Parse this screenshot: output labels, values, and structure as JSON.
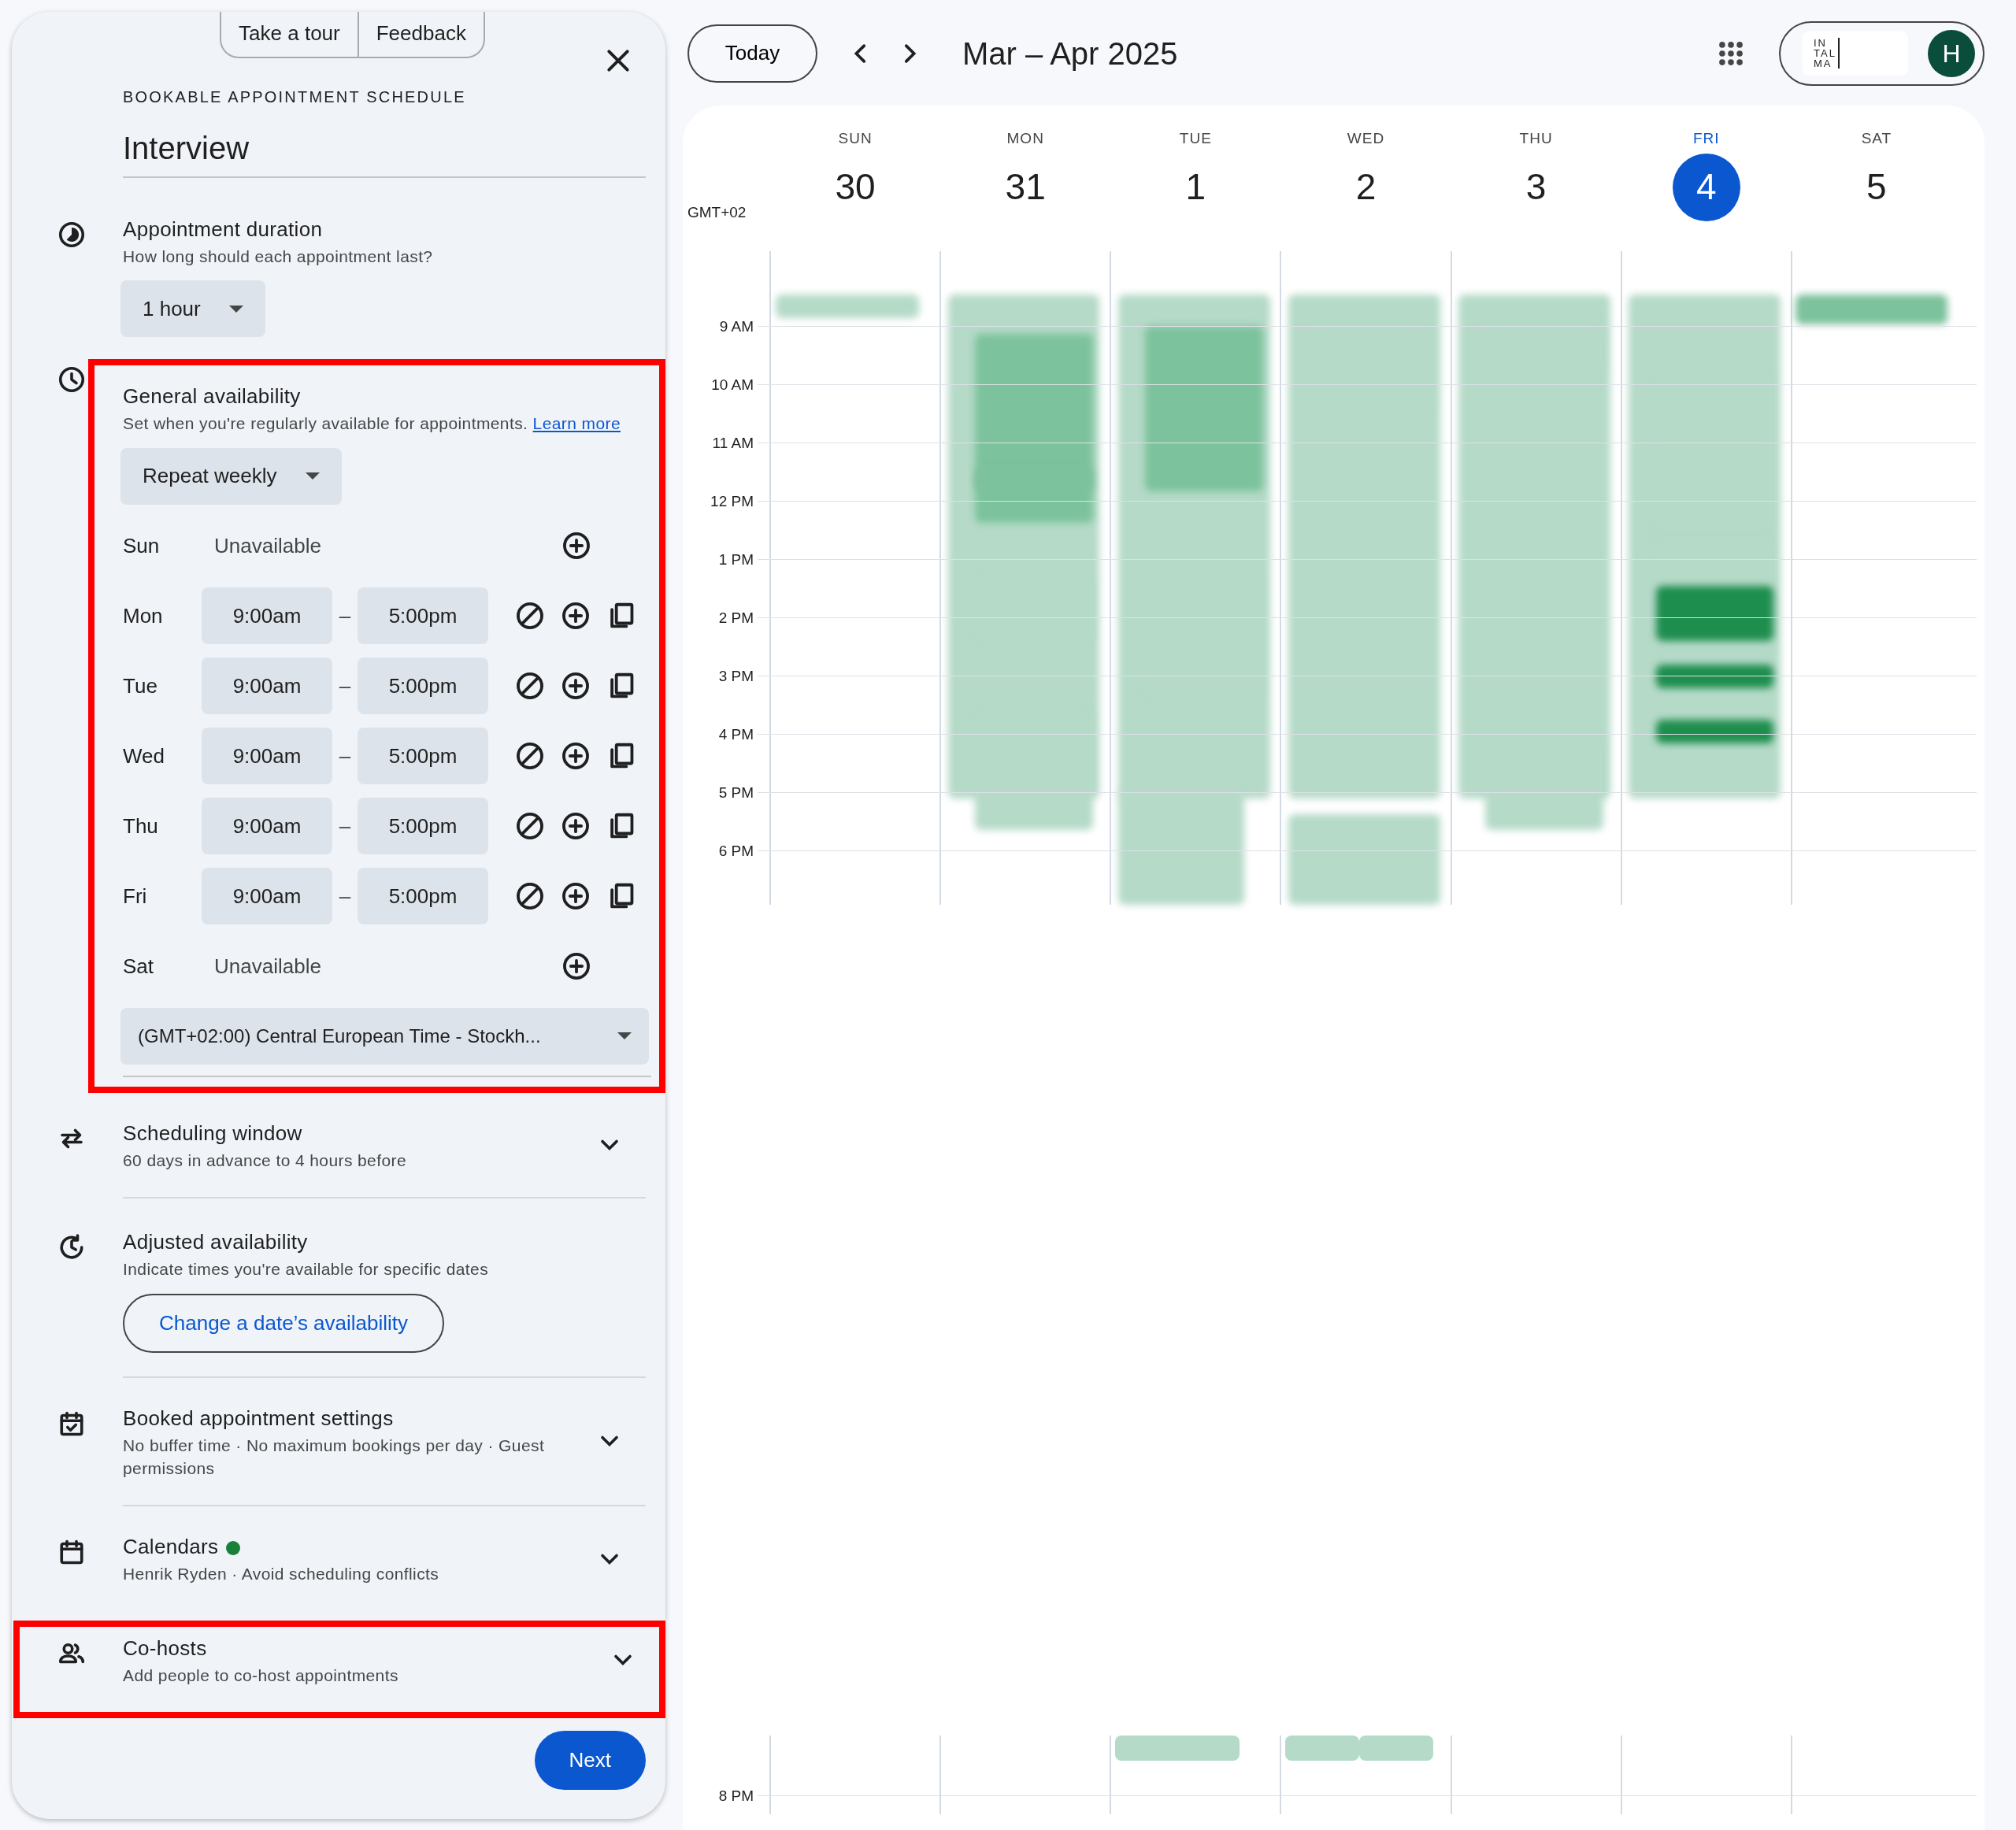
{
  "panel": {
    "top_buttons": [
      "Take a tour",
      "Feedback"
    ],
    "kicker": "BOOKABLE APPOINTMENT SCHEDULE",
    "title": "Interview",
    "sections": [
      {
        "kind": "duration",
        "title": "Appointment duration",
        "subtitle": "How long should each appointment last?",
        "select": "1 hour",
        "highlighted": false
      },
      {
        "kind": "availability",
        "title": "General availability",
        "subtitle": "Set when you're regularly available for appointments.",
        "link": "Learn more",
        "highlighted": true,
        "repeat": "Repeat weekly",
        "days": [
          {
            "day": "Sun",
            "available": false,
            "text": "Unavailable"
          },
          {
            "day": "Mon",
            "available": true,
            "start": "9:00am",
            "dash": "–",
            "end": "5:00pm"
          },
          {
            "day": "Tue",
            "available": true,
            "start": "9:00am",
            "dash": "–",
            "end": "5:00pm"
          },
          {
            "day": "Wed",
            "available": true,
            "start": "9:00am",
            "dash": "–",
            "end": "5:00pm"
          },
          {
            "day": "Thu",
            "available": true,
            "start": "9:00am",
            "dash": "–",
            "end": "5:00pm"
          },
          {
            "day": "Fri",
            "available": true,
            "start": "9:00am",
            "dash": "–",
            "end": "5:00pm"
          },
          {
            "day": "Sat",
            "available": false,
            "text": "Unavailable"
          }
        ],
        "timezone": "(GMT+02:00) Central European Time - Stockh..."
      },
      {
        "kind": "collapsible",
        "title": "Scheduling window",
        "subtitle": "60 days in advance to 4 hours before",
        "highlighted": false
      },
      {
        "kind": "adjusted",
        "title": "Adjusted availability",
        "subtitle": "Indicate times you're available for specific dates",
        "button": "Change a date’s availability",
        "highlighted": false
      },
      {
        "kind": "collapsible",
        "title": "Booked appointment settings",
        "subtitle": "No buffer time · No maximum bookings per day · Guest permissions",
        "highlighted": false
      },
      {
        "kind": "collapsible",
        "title": "Calendars",
        "color": "#188038",
        "subtitle": "Henrik Ryden · Avoid scheduling conflicts",
        "highlighted": false
      },
      {
        "kind": "collapsible",
        "title": "Co-hosts",
        "subtitle": "Add people to co-host appointments",
        "highlighted": true
      }
    ],
    "next_button": "Next"
  },
  "calendar": {
    "today_button": "Today",
    "range": "Mar – Apr 2025",
    "timezone": "GMT+02",
    "days": [
      {
        "dow": "SUN",
        "date": "30",
        "selected": false
      },
      {
        "dow": "MON",
        "date": "31",
        "selected": false
      },
      {
        "dow": "TUE",
        "date": "1",
        "selected": false
      },
      {
        "dow": "WED",
        "date": "2",
        "selected": false
      },
      {
        "dow": "THU",
        "date": "3",
        "selected": false
      },
      {
        "dow": "FRI",
        "date": "4",
        "selected": true
      },
      {
        "dow": "SAT",
        "date": "5",
        "selected": false
      }
    ],
    "hours": [
      "9 AM",
      "10 AM",
      "11 AM",
      "12 PM",
      "1 PM",
      "2 PM",
      "3 PM",
      "4 PM",
      "5 PM",
      "6 PM"
    ],
    "bottom_hours": [
      "8 PM"
    ]
  },
  "account": {
    "logo_lines": [
      "IN",
      "TAL",
      "MA"
    ],
    "avatar": "H"
  }
}
